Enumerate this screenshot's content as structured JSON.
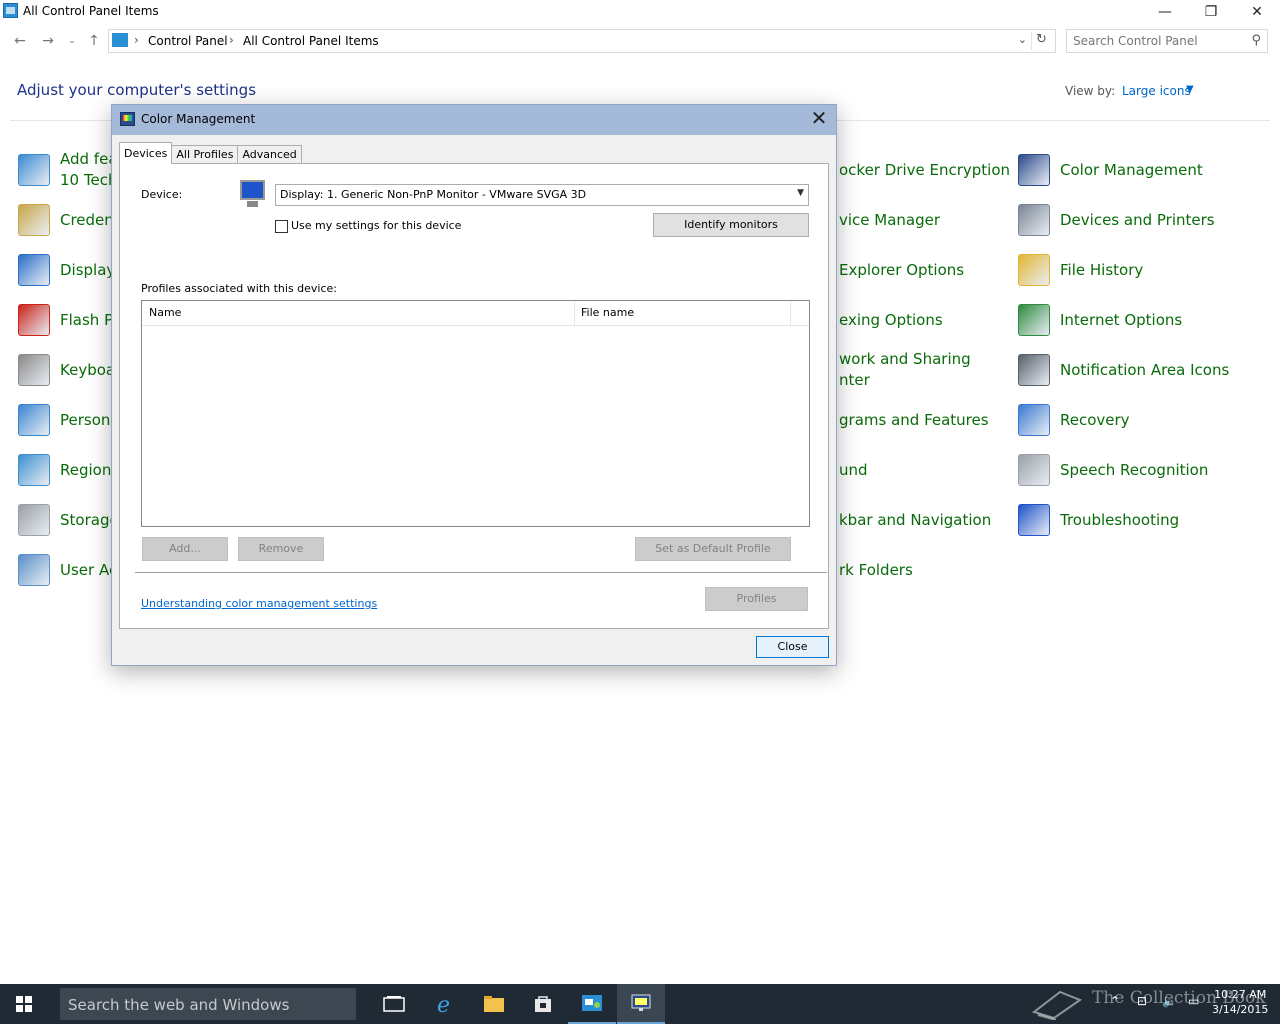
{
  "window": {
    "title": "All Control Panel Items",
    "controls": {
      "minimize": "—",
      "restore": "❐",
      "close": "✕"
    }
  },
  "addressbar": {
    "crumbs": [
      "Control Panel",
      "All Control Panel Items"
    ],
    "search_placeholder": "Search Control Panel"
  },
  "main": {
    "heading": "Adjust your computer's settings",
    "view_by_label": "View by:",
    "view_by_value": "Large icons",
    "items": [
      {
        "label": "Add fea\n10 Tech",
        "icon": "add-features-icon",
        "color": "#3b8bd1"
      },
      {
        "label": "Creden",
        "icon": "credential-manager-icon",
        "color": "#c8a74a"
      },
      {
        "label": "Display",
        "icon": "display-icon",
        "color": "#2a6fc7"
      },
      {
        "label": "Flash P",
        "icon": "flash-player-icon",
        "color": "#c9231c"
      },
      {
        "label": "Keyboa",
        "icon": "keyboard-icon",
        "color": "#8a8a8a"
      },
      {
        "label": "Persona",
        "icon": "personalization-icon",
        "color": "#3a86d0"
      },
      {
        "label": "Region",
        "icon": "region-icon",
        "color": "#3c8fcf"
      },
      {
        "label": "Storage",
        "icon": "storage-spaces-icon",
        "color": "#9aa0a6"
      },
      {
        "label": "User Ac",
        "icon": "user-accounts-icon",
        "color": "#5a8fc8"
      },
      {
        "label": "ocker Drive Encryption",
        "icon": "",
        "color": ""
      },
      {
        "label": "vice Manager",
        "icon": "",
        "color": ""
      },
      {
        "label": "Explorer Options",
        "icon": "",
        "color": ""
      },
      {
        "label": "exing Options",
        "icon": "",
        "color": ""
      },
      {
        "label": "work and Sharing\nnter",
        "icon": "",
        "color": ""
      },
      {
        "label": "grams and Features",
        "icon": "",
        "color": ""
      },
      {
        "label": "und",
        "icon": "",
        "color": ""
      },
      {
        "label": "kbar and Navigation",
        "icon": "",
        "color": ""
      },
      {
        "label": "rk Folders",
        "icon": "",
        "color": ""
      },
      {
        "label": "Color Management",
        "icon": "color-management-icon",
        "color": "#2c4a8c"
      },
      {
        "label": "Devices and Printers",
        "icon": "devices-printers-icon",
        "color": "#7a8593"
      },
      {
        "label": "File History",
        "icon": "file-history-icon",
        "color": "#e2b534"
      },
      {
        "label": "Internet Options",
        "icon": "internet-options-icon",
        "color": "#2f8b3f"
      },
      {
        "label": "Notification Area Icons",
        "icon": "notification-area-icon",
        "color": "#56606b"
      },
      {
        "label": "Recovery",
        "icon": "recovery-icon",
        "color": "#3a7ad1"
      },
      {
        "label": "Speech Recognition",
        "icon": "speech-recognition-icon",
        "color": "#9aa0a6"
      },
      {
        "label": "Troubleshooting",
        "icon": "troubleshooting-icon",
        "color": "#1f53c9"
      }
    ]
  },
  "dialog": {
    "title": "Color Management",
    "close_glyph": "✕",
    "tabs": [
      "Devices",
      "All Profiles",
      "Advanced"
    ],
    "device_label": "Device:",
    "device_value": "Display: 1. Generic Non-PnP Monitor - VMware SVGA 3D",
    "use_my_settings": "Use my settings for this device",
    "identify_button": "Identify monitors",
    "profiles_label": "Profiles associated with this device:",
    "columns": [
      "Name",
      "File name"
    ],
    "add_button": "Add...",
    "remove_button": "Remove",
    "set_default_button": "Set as Default Profile",
    "help_link": "Understanding color management settings",
    "profiles_button": "Profiles",
    "close_button": "Close"
  },
  "taskbar": {
    "search_placeholder": "Search the web and Windows",
    "time": "10:27 AM",
    "date": "3/14/2015",
    "watermark": "The Collection Book"
  }
}
